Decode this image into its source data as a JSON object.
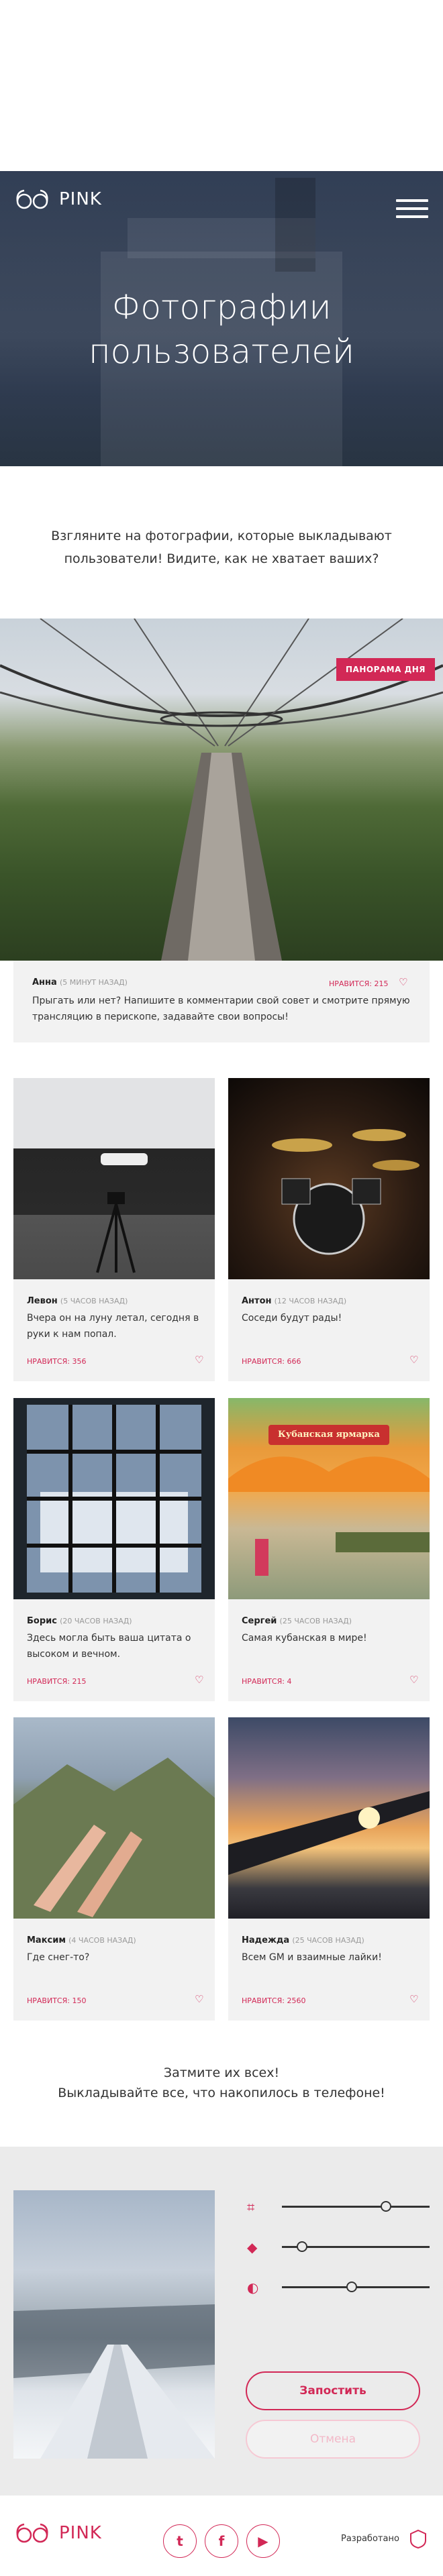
{
  "header": {
    "logo_text": "PINK",
    "menu_icon": "hamburger-icon"
  },
  "hero": {
    "title_line1": "Фотографии",
    "title_line2": "пользователей"
  },
  "intro": {
    "line1": "Взгляните на фотографии, которые выкладывают",
    "line2": "пользователи! Видите, как не хватает ваших?"
  },
  "panorama": {
    "badge": "ПАНОРАМА ДНЯ",
    "author": "Анна",
    "time": "(5 МИНУТ НАЗАД)",
    "likes": "НРАВИТСЯ: 215",
    "text_line1": "Прыгать или нет? Напишите в комментарии свой совет и смотрите прямую",
    "text_line2": "трансляцию в перископе, задавайте свои вопросы!"
  },
  "posts": [
    {
      "author": "Левон",
      "time": "(5 ЧАСОВ НАЗАД)",
      "line1": "Вчера он на луну летал, сегодня в",
      "line2": "руки к нам попал.",
      "likes": "НРАВИТСЯ: 356"
    },
    {
      "author": "Антон",
      "time": "(12 ЧАСОВ НАЗАД)",
      "line1": "Соседи будут рады!",
      "line2": "",
      "likes": "НРАВИТСЯ: 666"
    },
    {
      "author": "Борис",
      "time": "(20 ЧАСОВ НАЗАД)",
      "line1": "Здесь могла быть ваша цитата о",
      "line2": "высоком и вечном.",
      "likes": "НРАВИТСЯ: 215"
    },
    {
      "author": "Сергей",
      "time": "(25 ЧАСОВ НАЗАД)",
      "line1": "Самая кубанская в мире!",
      "line2": "",
      "likes": "НРАВИТСЯ: 4",
      "sign": "Кубанская ярмарка"
    },
    {
      "author": "Максим",
      "time": "(4 ЧАСОВ НАЗАД)",
      "line1": "Где снег-то?",
      "line2": "",
      "likes": "НРАВИТСЯ: 150"
    },
    {
      "author": "Надежда",
      "time": "(25 ЧАСОВ НАЗАД)",
      "line1": "Всем GM и взаимные лайки!",
      "line2": "",
      "likes": "НРАВИТСЯ: 2560"
    }
  ],
  "cta": {
    "line1": "Затмите их всех!",
    "line2": "Выкладывайте все, что накопилось в телефоне!"
  },
  "editor": {
    "tools": [
      {
        "icon": "crop-icon",
        "value": 0.8
      },
      {
        "icon": "fill-icon",
        "value": 0.13
      },
      {
        "icon": "contrast-icon",
        "value": 0.5
      }
    ],
    "submit_label": "Запостить",
    "cancel_label": "Отмена"
  },
  "footer": {
    "logo_text": "PINK",
    "social": [
      "twitter-icon",
      "facebook-icon",
      "youtube-icon"
    ],
    "dev_label": "Разработано"
  },
  "colors": {
    "accent": "#d22856",
    "dark": "#263248"
  }
}
